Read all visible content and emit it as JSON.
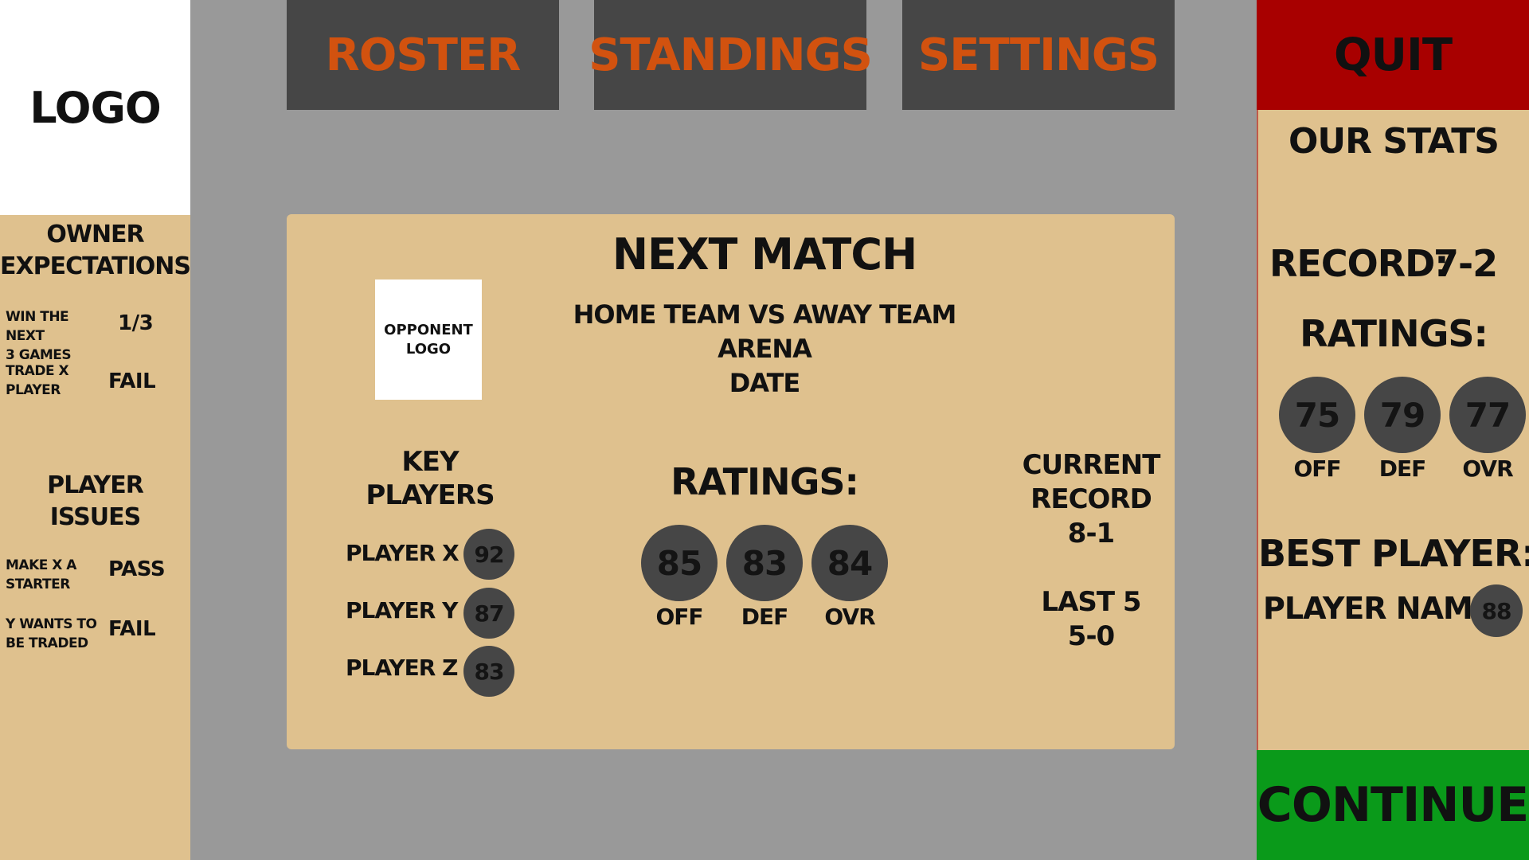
{
  "logo": "LOGO",
  "nav": {
    "roster": "ROSTER",
    "standings": "STANDINGS",
    "settings": "SETTINGS",
    "quit": "QUIT",
    "continue": "CONTINUE"
  },
  "colors": {
    "background": "#999999",
    "panel": "#dfc18e",
    "button_dark": "#464646",
    "nav_text": "#d2520f",
    "quit": "#a80000",
    "continue": "#0a9a1a"
  },
  "owner_expectations": {
    "title_line1": "OWNER",
    "title_line2": "EXPECTATIONS",
    "items": [
      {
        "line1": "WIN THE NEXT",
        "line2": "3 GAMES",
        "value": "1/3"
      },
      {
        "line1": "TRADE X",
        "line2": "PLAYER",
        "value": "FAIL"
      }
    ]
  },
  "player_issues": {
    "title_line1": "PLAYER",
    "title_line2": "ISSUES",
    "items": [
      {
        "line1": "MAKE X A",
        "line2": "STARTER",
        "value": "PASS"
      },
      {
        "line1": "Y WANTS TO",
        "line2": "BE TRADED",
        "value": "FAIL"
      }
    ]
  },
  "next_match": {
    "title": "NEXT MATCH",
    "opponent_logo_line1": "OPPONENT",
    "opponent_logo_line2": "LOGO",
    "teams": "HOME TEAM VS AWAY TEAM",
    "arena": "ARENA",
    "date": "DATE",
    "key_players_line1": "KEY",
    "key_players_line2": "PLAYERS",
    "key_players": [
      {
        "name": "PLAYER X",
        "rating": "92"
      },
      {
        "name": "PLAYER Y",
        "rating": "87"
      },
      {
        "name": "PLAYER Z",
        "rating": "83"
      }
    ],
    "ratings_title": "RATINGS:",
    "ratings": [
      {
        "label": "OFF",
        "value": "85"
      },
      {
        "label": "DEF",
        "value": "83"
      },
      {
        "label": "OVR",
        "value": "84"
      }
    ],
    "current_record_line1": "CURRENT",
    "current_record_line2": "RECORD",
    "current_record": "8-1",
    "last5_label": "LAST 5",
    "last5": "5-0"
  },
  "our_stats": {
    "title": "OUR STATS",
    "record_label": "RECORD:",
    "record": "7-2",
    "ratings_title": "RATINGS:",
    "ratings": [
      {
        "label": "OFF",
        "value": "75"
      },
      {
        "label": "DEF",
        "value": "79"
      },
      {
        "label": "OVR",
        "value": "77"
      }
    ],
    "best_player_title": "BEST PLAYER:",
    "best_player_name": "PLAYER NAME",
    "best_player_rating": "88"
  }
}
